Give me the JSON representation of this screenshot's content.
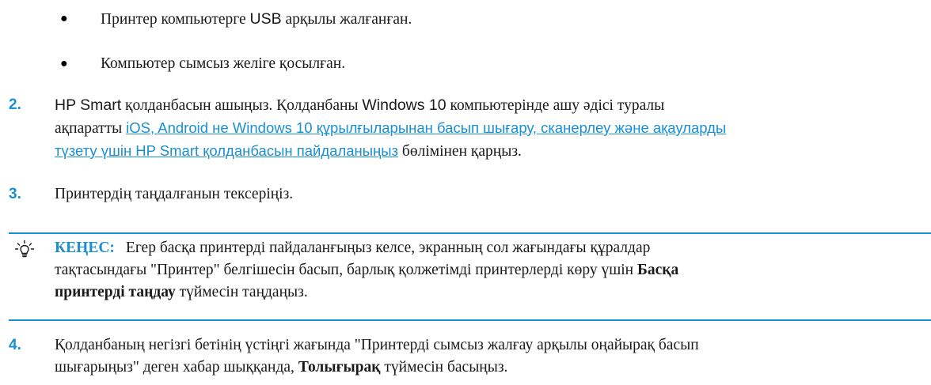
{
  "bullets": [
    {
      "prefix": "Принтер компьютерге ",
      "sans": "USB",
      "suffix": " арқылы жалғанған."
    },
    {
      "text": "Компьютер сымсыз желіге қосылған."
    }
  ],
  "bullet_symbol": "●",
  "steps": {
    "s2": {
      "number": "2.",
      "line1_sans1": "HP Smart",
      "line1_text1": " қолданбасын ашыңыз. Қолданбаны ",
      "line1_sans2": "Windows 10",
      "line1_text2": " компьютерінде ашу әдісі туралы",
      "line2_text": "ақпаратты ",
      "link_line2": "iOS, Android не Windows 10 құрылғыларынан басып шығару, сканерлеу және ақауларды",
      "link_line3": "түзету үшін HP Smart қолданбасын пайдаланыңыз",
      "line3_text": " бөлімінен қарңыз."
    },
    "s3": {
      "number": "3.",
      "text": "Принтердің таңдалғанын тексеріңіз."
    },
    "s4": {
      "number": "4.",
      "line1": "Қолданбаның негізгі бетінің үстіңгі жағында \"Принтерді сымсыз жалғау арқылы оңайырақ басып",
      "line2_pre": "шығарыңыз\" деген хабар шыққанда, ",
      "line2_bold": "Толығырақ",
      "line2_post": " түймесін басыңыз."
    }
  },
  "tip": {
    "label": "КЕҢЕС:",
    "line1": "Егер басқа принтерді пайдаланғыңыз келсе, экранның сол жағындағы құралдар",
    "line2_pre": "тақтасындағы \"Принтер\" белгішесін басып, барлық қолжетімді принтерлерді көру үшін ",
    "line2_bold": "Басқа",
    "line3_bold": "принтерді таңдау",
    "line3_post": " түймесін таңдаңыз.",
    "icon": "lightbulb-icon",
    "accent_color": "#1a8fd1"
  }
}
